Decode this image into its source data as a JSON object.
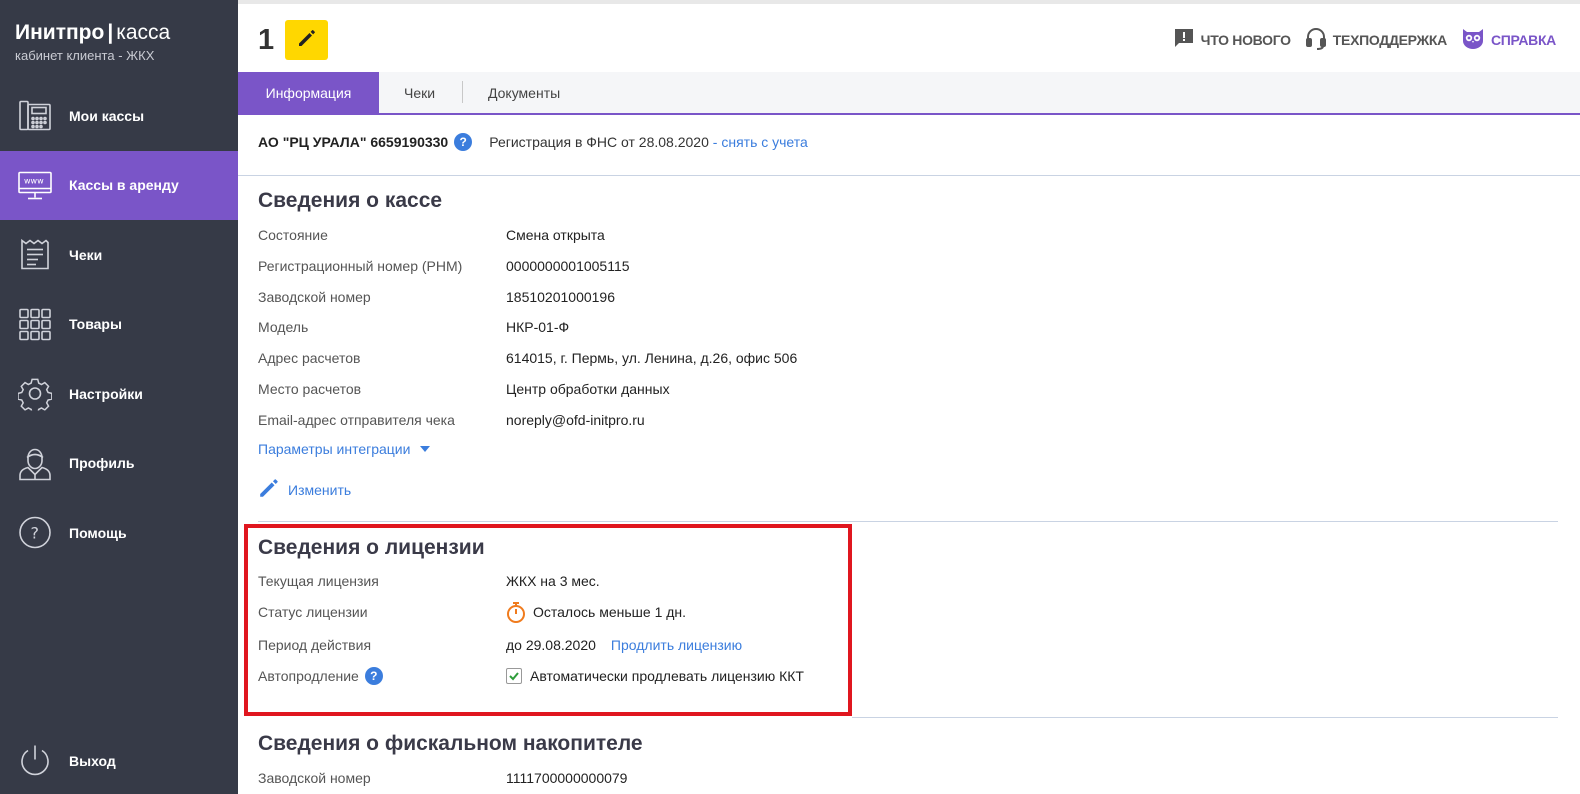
{
  "brand": {
    "name": "Инитпро",
    "separator": "|",
    "product": "касса",
    "subtitle": "кабинет клиента - ЖКХ"
  },
  "sidebar": {
    "items": [
      {
        "label": "Мои кассы",
        "icon": "cash-register-icon",
        "active": false
      },
      {
        "label": "Кассы в аренду",
        "icon": "monitor-www-icon",
        "active": true
      },
      {
        "label": "Чеки",
        "icon": "receipt-icon",
        "active": false
      },
      {
        "label": "Товары",
        "icon": "grid-icon",
        "active": false
      },
      {
        "label": "Настройки",
        "icon": "gear-icon",
        "active": false
      },
      {
        "label": "Профиль",
        "icon": "user-icon",
        "active": false
      },
      {
        "label": "Помощь",
        "icon": "question-icon",
        "active": false
      }
    ],
    "logout": {
      "label": "Выход",
      "icon": "power-icon"
    }
  },
  "header": {
    "kassa_number": "1",
    "links": {
      "whats_new": "Что нового",
      "support": "Техподдержка",
      "help": "Справка"
    }
  },
  "tabs": {
    "info": "Информация",
    "receipts": "Чеки",
    "documents": "Документы"
  },
  "org": {
    "name": "АО \"РЦ УРАЛА\" 6659190330",
    "registration": "Регистрация в ФНС от 28.08.2020",
    "unregister_prefix": " - ",
    "unregister_link": "снять с учета"
  },
  "kassa_info": {
    "title": "Сведения о кассе",
    "rows": [
      {
        "label": "Состояние",
        "value": "Смена открыта"
      },
      {
        "label": "Регистрационный номер (РНМ)",
        "value": "0000000001005115"
      },
      {
        "label": "Заводской номер",
        "value": "18510201000196"
      },
      {
        "label": "Модель",
        "value": "НКР-01-Ф"
      },
      {
        "label": "Адрес расчетов",
        "value": "614015, г. Пермь, ул. Ленина, д.26, офис 506"
      },
      {
        "label": "Место расчетов",
        "value": "Центр обработки данных"
      },
      {
        "label": "Email-адрес отправителя чека",
        "value": "noreply@ofd-initpro.ru"
      }
    ],
    "integration_link": "Параметры интеграции",
    "change_link": "Изменить"
  },
  "license": {
    "title": "Сведения о лицензии",
    "current_label": "Текущая лицензия",
    "current_value": "ЖКХ на 3 мес.",
    "status_label": "Статус лицензии",
    "status_value": "Осталось меньше 1 дн.",
    "period_label": "Период действия",
    "period_value": "до 29.08.2020",
    "extend_link": "Продлить лицензию",
    "auto_label": "Автопродление",
    "auto_checkbox_label": "Автоматически продлевать лицензию ККТ",
    "auto_checked": true
  },
  "fiscal": {
    "title": "Сведения о фискальном накопителе",
    "serial_label": "Заводской номер",
    "serial_value": "1111700000000079"
  },
  "colors": {
    "sidebar": "#363a47",
    "accent": "#7a55c8",
    "edit_button": "#ffd700",
    "link": "#3b7ddd",
    "highlight": "#e0161f",
    "timer": "#f07b1d",
    "check": "#2e9d3a"
  }
}
